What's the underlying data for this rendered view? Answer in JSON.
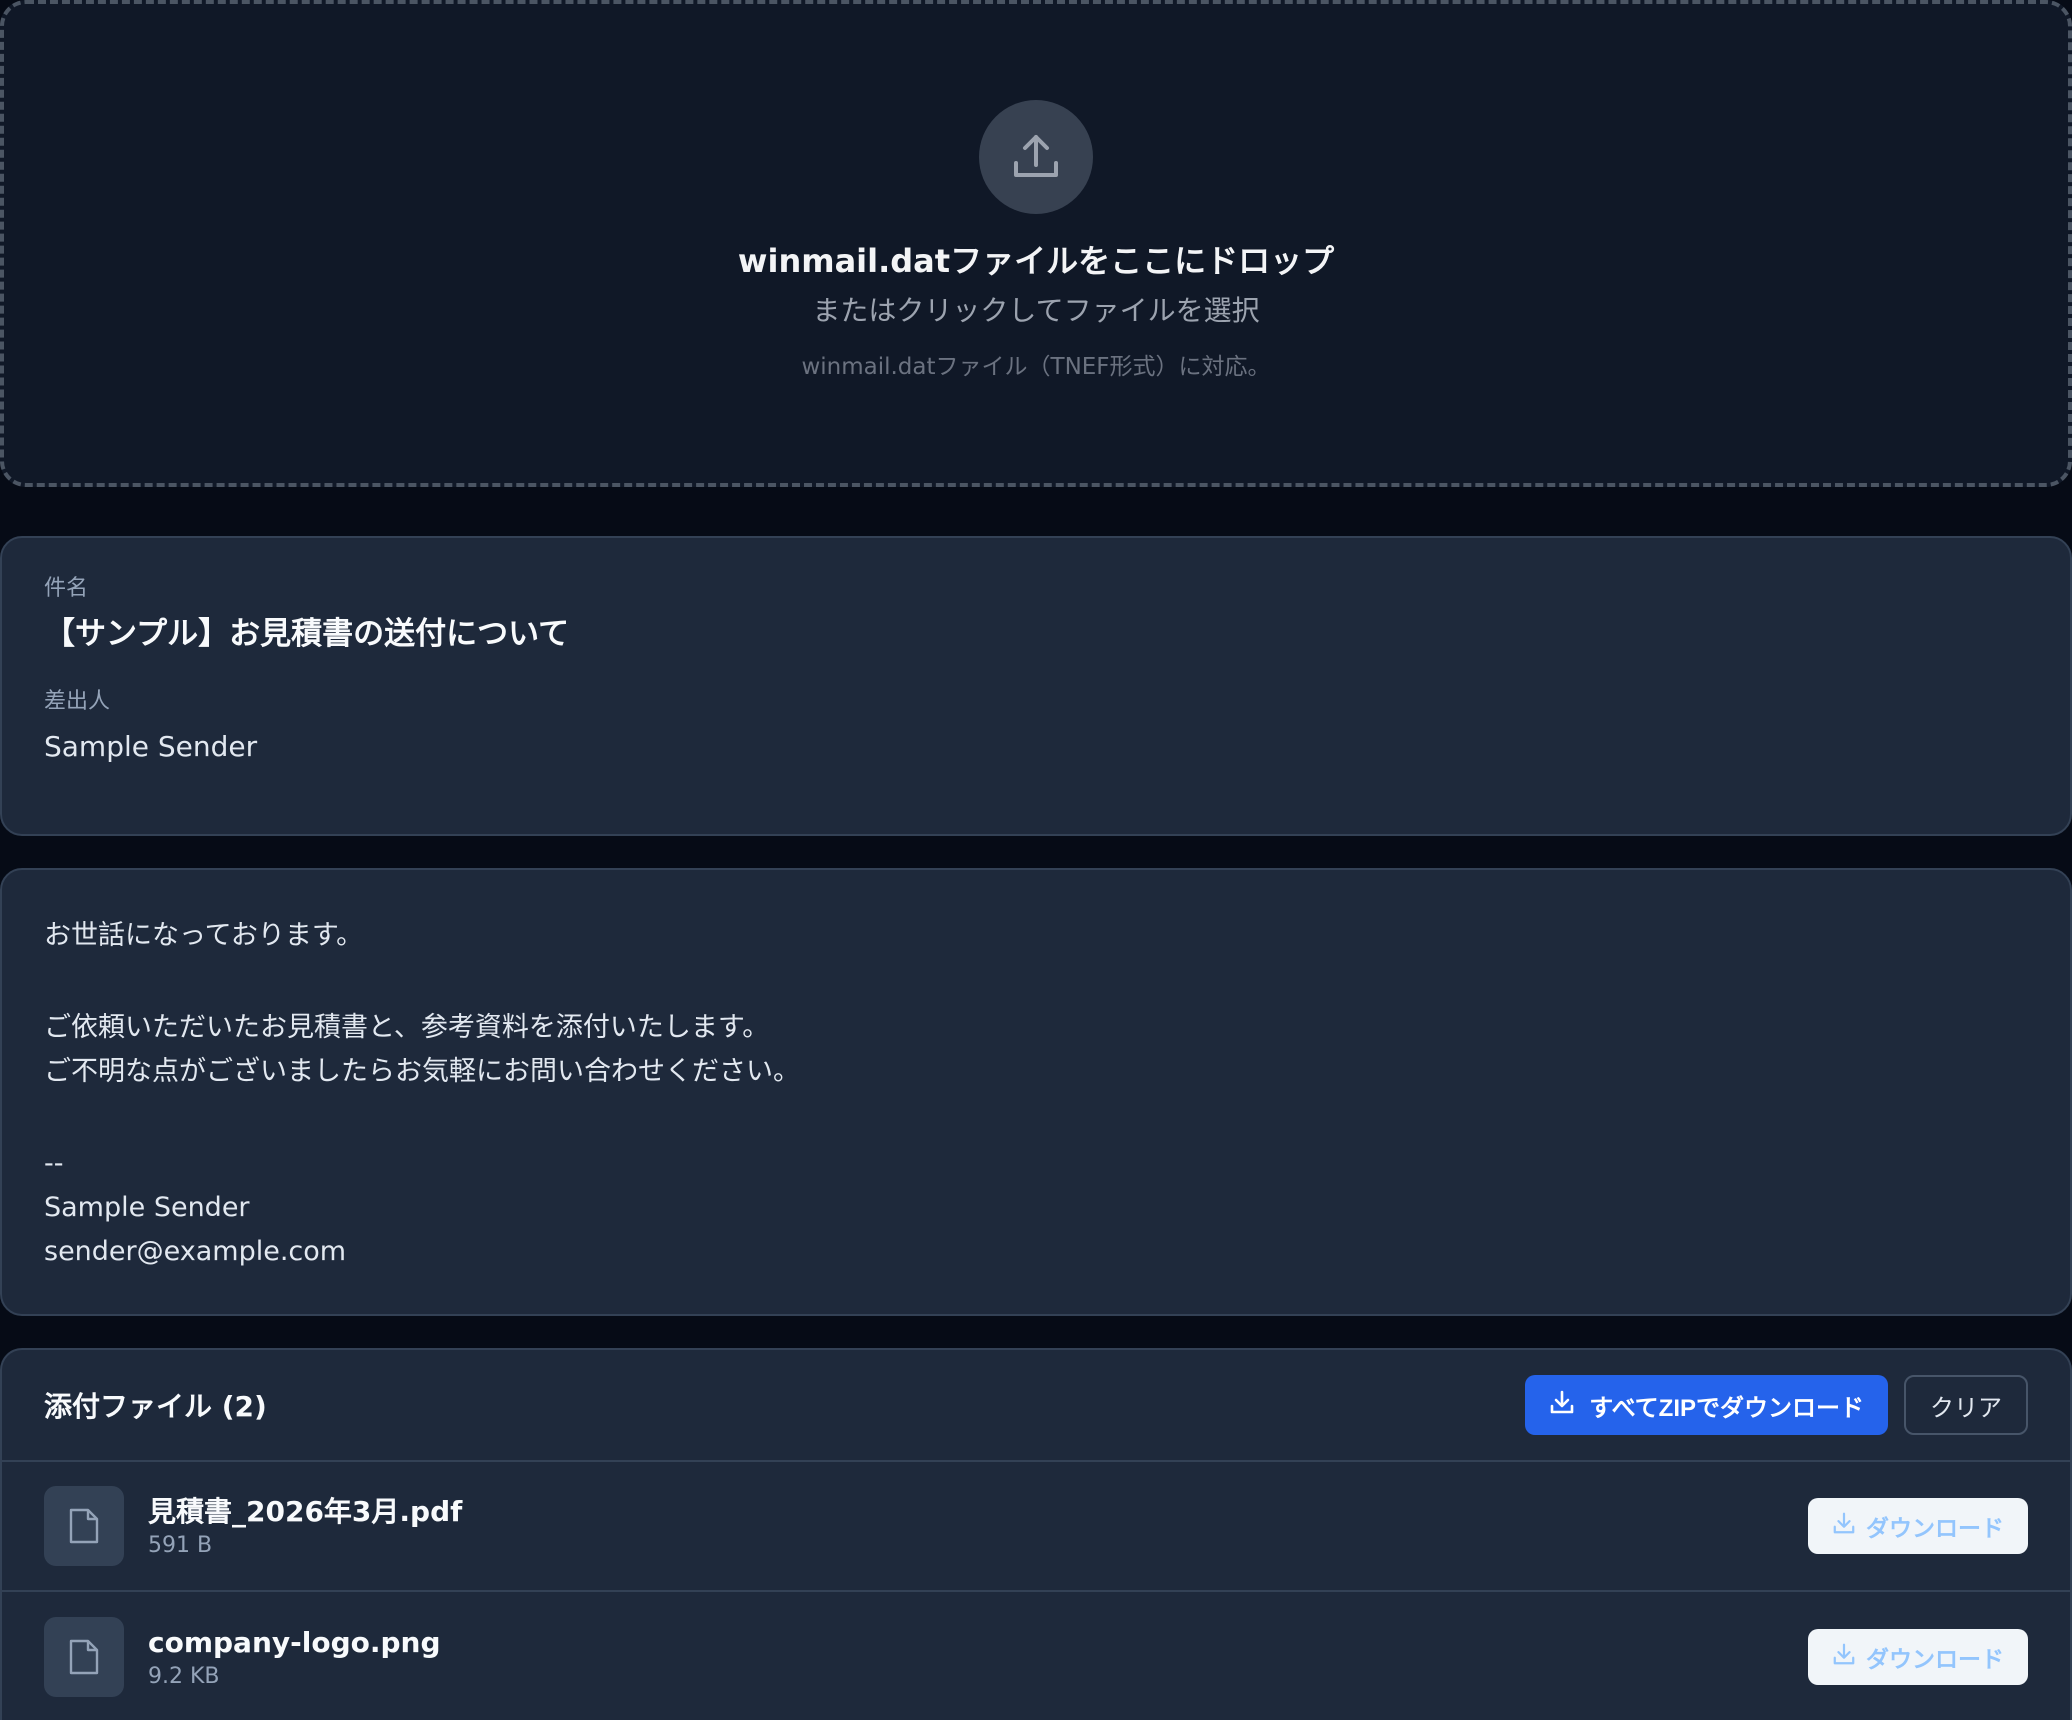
{
  "dropzone": {
    "icon": "upload-icon",
    "title": "winmail.datファイルをここにドロップ",
    "subtitle": "またはクリックしてファイルを選択",
    "note": "winmail.datファイル（TNEF形式）に対応。"
  },
  "message": {
    "subject_label": "件名",
    "subject": "【サンプル】お見積書の送付について",
    "sender_label": "差出人",
    "sender": "Sample Sender"
  },
  "body": {
    "lines": [
      "お世話になっております。",
      "",
      "ご依頼いただいたお見積書と、参考資料を添付いたします。",
      "ご不明な点がございましたらお気軽にお問い合わせください。",
      "",
      "--",
      "Sample Sender",
      "sender@example.com"
    ]
  },
  "attachments": {
    "title": "添付ファイル (2)",
    "zip_label": "すべてZIPでダウンロード",
    "clear_label": "クリア",
    "download_label": "ダウンロード",
    "files": [
      {
        "name": "見積書_2026年3月.pdf",
        "size": "591 B",
        "icon": "file-icon"
      },
      {
        "name": "company-logo.png",
        "size": "9.2 KB",
        "icon": "file-icon"
      }
    ]
  },
  "colors": {
    "background": "#060b16",
    "card": "#1e293b",
    "accent": "#2563eb"
  }
}
